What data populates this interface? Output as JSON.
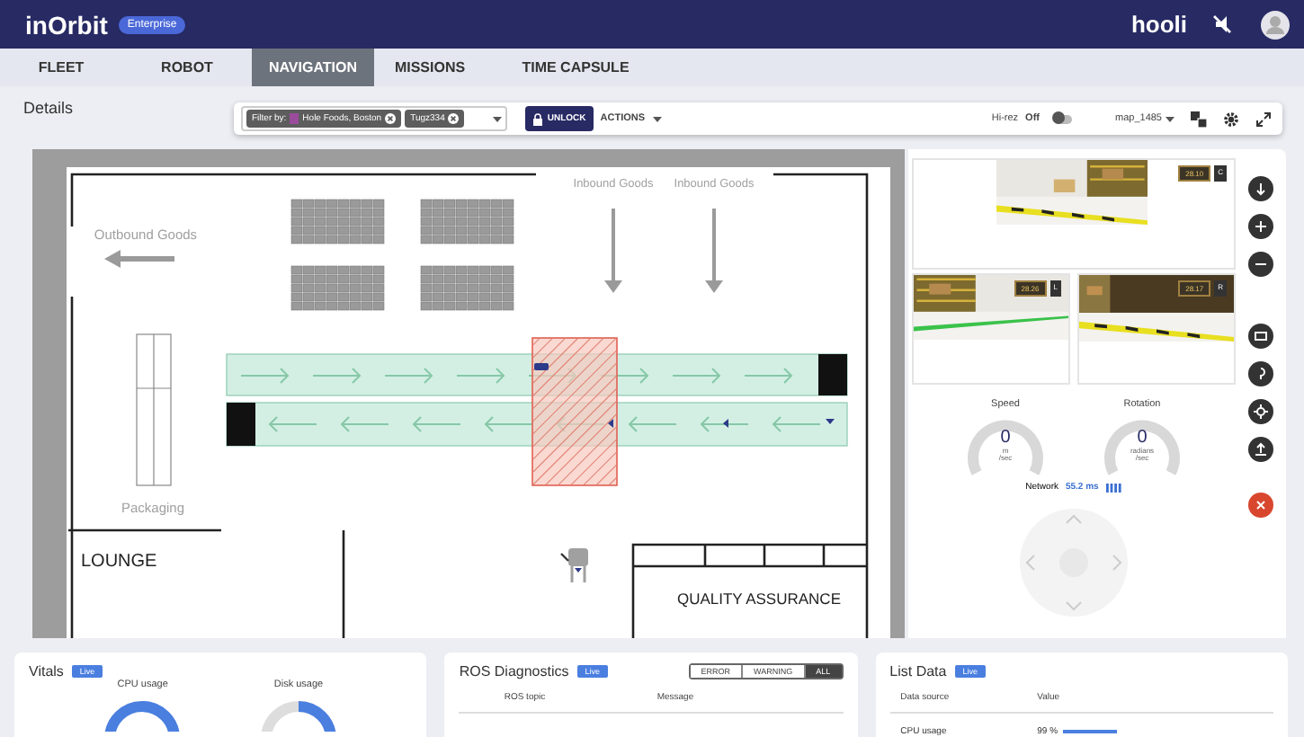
{
  "header": {
    "logo": "inOrbit",
    "edition": "Enterprise",
    "brand": "hooli"
  },
  "tabs": [
    {
      "label": "FLEET",
      "selected": false
    },
    {
      "label": "ROBOT",
      "selected": false
    },
    {
      "label": "NAVIGATION",
      "selected": true
    },
    {
      "label": "MISSIONS",
      "selected": false
    },
    {
      "label": "TIME CAPSULE",
      "selected": false
    }
  ],
  "details": {
    "title": "Details",
    "filter_label": "Filter by:",
    "chips": [
      {
        "label": "Hole Foods, Boston",
        "color": "#9b4b9b"
      },
      {
        "label": "Tugz334"
      }
    ],
    "unlock": "UNLOCK",
    "actions": "ACTIONS",
    "hirez_label": "Hi-rez",
    "hirez_state": "Off",
    "hirez_on": false,
    "map_name": "map_1485"
  },
  "map": {
    "labels": [
      {
        "kind": "zone",
        "text": "Outbound Goods"
      },
      {
        "kind": "zone",
        "text": "Inbound Goods"
      },
      {
        "kind": "zone",
        "text": "Inbound Goods"
      },
      {
        "kind": "zone",
        "text": "Packaging"
      },
      {
        "kind": "room",
        "text": "LOUNGE"
      },
      {
        "kind": "room",
        "text": "QUALITY ASSURANCE"
      }
    ]
  },
  "cameras": [
    {
      "reading": "28.10",
      "position": "C"
    },
    {
      "reading": "28.26",
      "position": "L"
    },
    {
      "reading": "28.17",
      "position": "R"
    }
  ],
  "gauges": [
    {
      "label": "Speed",
      "value": "0",
      "unit": "m",
      "per": "/sec"
    },
    {
      "label": "Rotation",
      "value": "0",
      "unit": "radians",
      "per": "/sec"
    }
  ],
  "network": {
    "label": "Network",
    "value": "55.2 ms"
  },
  "vitals": {
    "title": "Vitals",
    "badge": "Live",
    "meters": [
      {
        "label": "CPU usage"
      },
      {
        "label": "Disk usage"
      }
    ]
  },
  "ros": {
    "title": "ROS Diagnostics",
    "badge": "Live",
    "filters": [
      {
        "label": "ERROR",
        "selected": false
      },
      {
        "label": "WARNING",
        "selected": false
      },
      {
        "label": "ALL",
        "selected": true
      }
    ],
    "columns": [
      "ROS topic",
      "Message"
    ]
  },
  "list_data": {
    "title": "List Data",
    "badge": "Live",
    "columns": [
      "Data source",
      "Value"
    ],
    "rows": [
      {
        "source": "CPU usage",
        "value": "99 %",
        "level": 0.99
      }
    ]
  }
}
